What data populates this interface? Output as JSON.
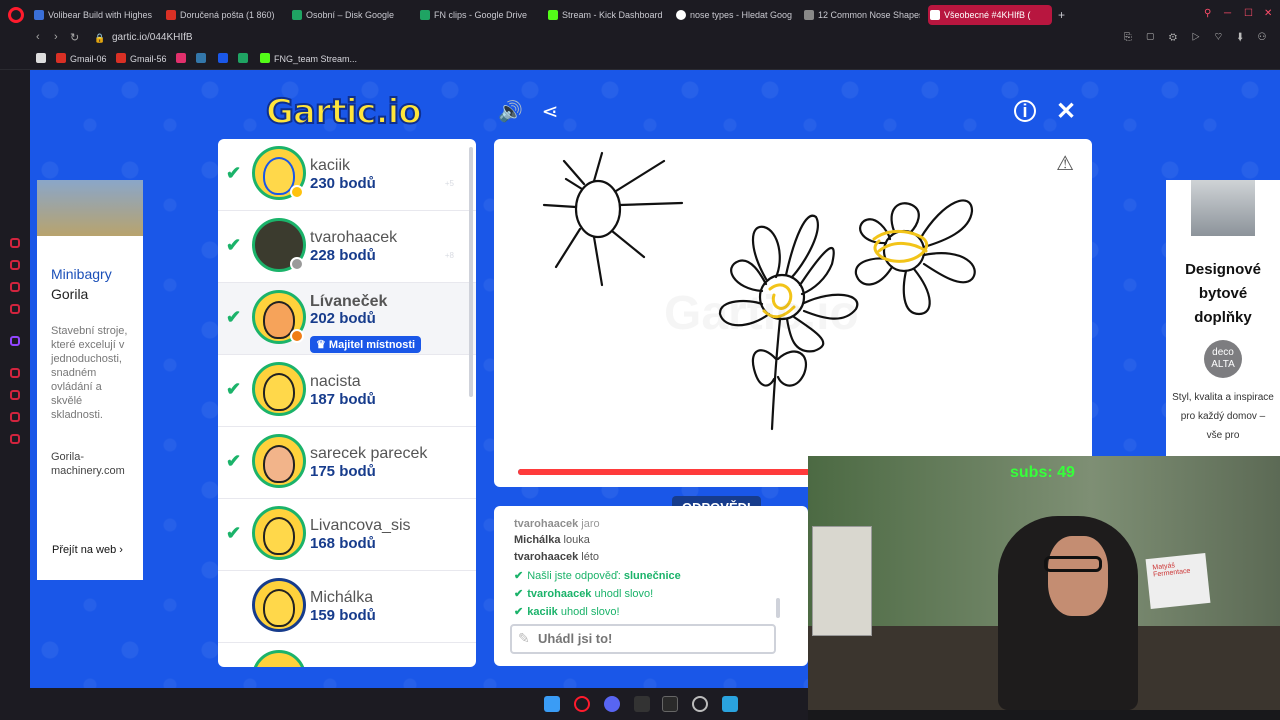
{
  "browser": {
    "tabs": [
      {
        "label": "Volibear Build with Highest",
        "color": "#3a6fd8"
      },
      {
        "label": "Doručená pošta (1 860) -",
        "color": "#d93025"
      },
      {
        "label": "Osobní – Disk Google",
        "color": "#1fa463"
      },
      {
        "label": "FN clips - Google Drive",
        "color": "#1fa463"
      },
      {
        "label": "Stream - Kick Dashboard",
        "color": "#53fc18"
      },
      {
        "label": "nose types - Hledat Goog",
        "color": "#ffffff"
      },
      {
        "label": "12 Common Nose Shapes",
        "color": "#888888"
      },
      {
        "label": "Všeobecné #4KHIfB (",
        "color": "#ffffff"
      }
    ],
    "url": "gartic.io/044KHIfB",
    "bookmarks": [
      "Gmail-06",
      "Gmail-56",
      "",
      "",
      "",
      "",
      "FNG_team Stream..."
    ]
  },
  "game": {
    "logo": "Gartic.io",
    "accent": "#1a57e8",
    "players": [
      {
        "name": "kaciik",
        "score": "230 bodů",
        "guessed": true,
        "avatar": "curly",
        "ghost": "+5"
      },
      {
        "name": "tvarohaacek",
        "score": "228 bodů",
        "guessed": true,
        "avatar": "photo",
        "ghost": "+8"
      },
      {
        "name": "Lívaneček",
        "score": "202 bodů",
        "guessed": true,
        "avatar": "orange",
        "badge": "Majitel místnosti"
      },
      {
        "name": "nacista",
        "score": "187 bodů",
        "guessed": true,
        "avatar": "default"
      },
      {
        "name": "sarecek parecek",
        "score": "175 bodů",
        "guessed": true,
        "avatar": "beard"
      },
      {
        "name": "Livancova_sis",
        "score": "168 bodů",
        "guessed": true,
        "avatar": "default"
      },
      {
        "name": "Michálka",
        "score": "159 bodů",
        "guessed": false,
        "avatar": "default"
      }
    ],
    "answers_tab": "ODPOVĚDI",
    "answers": [
      {
        "user": "tvarohaacek",
        "text": "jaro"
      },
      {
        "user": "Michálka",
        "text": "louka"
      },
      {
        "user": "tvarohaacek",
        "text": "léto"
      }
    ],
    "system": {
      "found_prefix": "Našli jste odpověď:",
      "found_word": "slunečnice",
      "guess1_user": "tvarohaacek",
      "guess1_text": "uhodl slovo!",
      "guess2_user": "kaciik",
      "guess2_text": "uhodl slovo!"
    },
    "input_placeholder": "Uhádl jsi to!",
    "progress": 0.52
  },
  "ads": {
    "left": {
      "title": "Minibagry",
      "subtitle": "Gorila",
      "body": "Stavební stroje, které excelují v jednoduchosti, snadném ovládání a skvělé skladnosti.",
      "site": "Gorila-machinery.com",
      "cta": "Přejít na web"
    },
    "right": {
      "title": "Designové bytové doplňky",
      "logo": "deco ALTA",
      "body": "Styl, kvalita a inspirace pro každý domov – vše pro"
    }
  },
  "webcam": {
    "overlay": "subs: 49",
    "board_text": "Matyáš Fermentace"
  }
}
